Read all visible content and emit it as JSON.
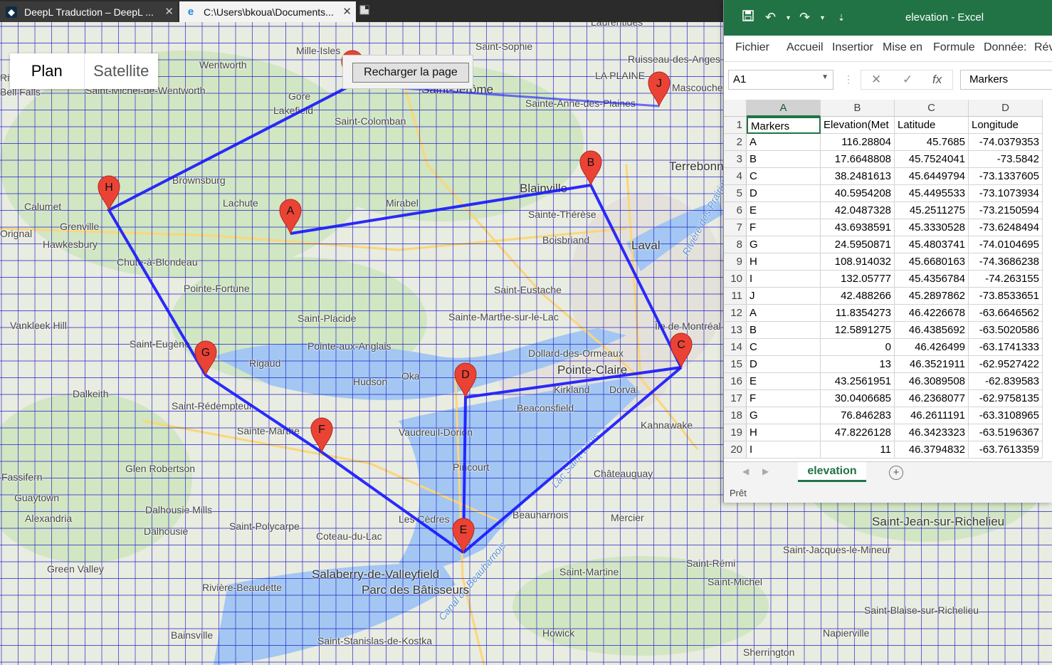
{
  "browser": {
    "tabs": [
      {
        "title": "DeepL Traduction – DeepL ...",
        "icon": "deepl-icon"
      },
      {
        "title": "C:\\Users\\bkoua\\Documents...",
        "icon": "ie-icon"
      }
    ],
    "new_tab_icon": "new-tab-icon"
  },
  "map": {
    "map_types": [
      "Plan",
      "Satellite"
    ],
    "reload_button": "Recharger la page",
    "marker_color": "#ea4335",
    "route_color": "#1515ff",
    "markers": [
      "A",
      "B",
      "C",
      "D",
      "E",
      "F",
      "G",
      "H",
      "I",
      "J"
    ],
    "places": [
      "Wentworth",
      "Mille-Isles",
      "Saint-Sophie",
      "Ruisseau-des-Anges",
      "Laurentides",
      "Rivington",
      "Bell Falls",
      "Saint-Michel-de-Wentworth",
      "Gore",
      "Lakefield",
      "Saint-Jérôme",
      "LA PLAINE",
      "Mascouche",
      "Sainte-Anne-des-Plaines",
      "Saint-Colomban",
      "Terrebonne",
      "Brownsburg",
      "Calumet",
      "Grenville",
      "Lachute",
      "Mirabel",
      "Blainville",
      "Sainte-Thérèse",
      "Orignal",
      "Hawkesbury",
      "Boisbriand",
      "Laval",
      "Chute-à-Blondeau",
      "Rivière des Prairies",
      "Pointe-Fortune",
      "Saint-Eustache",
      "Saint-Placide",
      "Sainte-Marthe-sur-le-Lac",
      "Vankleek Hill",
      "Saint-Eugène",
      "Pointe-aux-Anglais",
      "Île de Montréal",
      "Rigaud",
      "Hudson",
      "Oka",
      "Dollard-des-Ormeaux",
      "Pointe-Claire",
      "Kirkland",
      "Dorval",
      "Dalkeith",
      "Saint-Rédempteur",
      "Beaconsfield",
      "Sainte-Marthe",
      "Vaudreuil-Dorion",
      "Kahnawake",
      "Pincourt",
      "Lac Saint-Louis",
      "Glen Robertson",
      "Châteauguay",
      "Fassifern",
      "Guaytown",
      "Alexandria",
      "Dalhousie Mills",
      "Dalhousie",
      "Saint-Polycarpe",
      "Les Cèdres",
      "Coteau-du-Lac",
      "Beauharnois",
      "Mercier",
      "Saint-Jean-sur-Richelieu",
      "Saint-Jacques-le-Mineur",
      "Green Valley",
      "Salaberry-de-Valleyfield",
      "Canal de Beauharnois",
      "Parc des Bâtisseurs",
      "Rivière-Beaudette",
      "Saint-Martine",
      "Saint-Rémi",
      "Saint-Michel",
      "Saint-Blaise-sur-Richelieu",
      "Bainsville",
      "Saint-Stanislas-de-Kostka",
      "Howick",
      "Napierville",
      "Sherrington"
    ]
  },
  "excel": {
    "title": "elevation  -  Excel",
    "ribbon_tabs": [
      "Fichier",
      "Accueil",
      "Insertior",
      "Mise en",
      "Formule",
      "Donnée:",
      "Rév"
    ],
    "name_box": "A1",
    "formula_value": "Markers",
    "column_letters": [
      "A",
      "B",
      "C",
      "D"
    ],
    "rows": [
      [
        "Markers",
        "Elevation(Met",
        "Latitude",
        "Longitude"
      ],
      [
        "A",
        "116.28804",
        "45.7685",
        "-74.0379353"
      ],
      [
        "B",
        "17.6648808",
        "45.7524041",
        "-73.5842"
      ],
      [
        "C",
        "38.2481613",
        "45.6449794",
        "-73.1337605"
      ],
      [
        "D",
        "40.5954208",
        "45.4495533",
        "-73.1073934"
      ],
      [
        "E",
        "42.0487328",
        "45.2511275",
        "-73.2150594"
      ],
      [
        "F",
        "43.6938591",
        "45.3330528",
        "-73.6248494"
      ],
      [
        "G",
        "24.5950871",
        "45.4803741",
        "-74.0104695"
      ],
      [
        "H",
        "108.914032",
        "45.6680163",
        "-74.3686238"
      ],
      [
        "I",
        "132.05777",
        "45.4356784",
        "-74.263155"
      ],
      [
        "J",
        "42.488266",
        "45.2897862",
        "-73.8533651"
      ],
      [
        "A",
        "11.8354273",
        "46.4226678",
        "-63.6646562"
      ],
      [
        "B",
        "12.5891275",
        "46.4385692",
        "-63.5020586"
      ],
      [
        "C",
        "0",
        "46.426499",
        "-63.1741333"
      ],
      [
        "D",
        "13",
        "46.3521911",
        "-62.9527422"
      ],
      [
        "E",
        "43.2561951",
        "46.3089508",
        "-62.839583"
      ],
      [
        "F",
        "30.0406685",
        "46.2368077",
        "-62.9758135"
      ],
      [
        "G",
        "76.846283",
        "46.2611191",
        "-63.3108965"
      ],
      [
        "H",
        "47.8226128",
        "46.3423323",
        "-63.5196367"
      ],
      [
        "I",
        "11",
        "46.3794832",
        "-63.7613359"
      ]
    ],
    "sheet_tab": "elevation",
    "status": "Prêt",
    "accent": "#217346"
  }
}
